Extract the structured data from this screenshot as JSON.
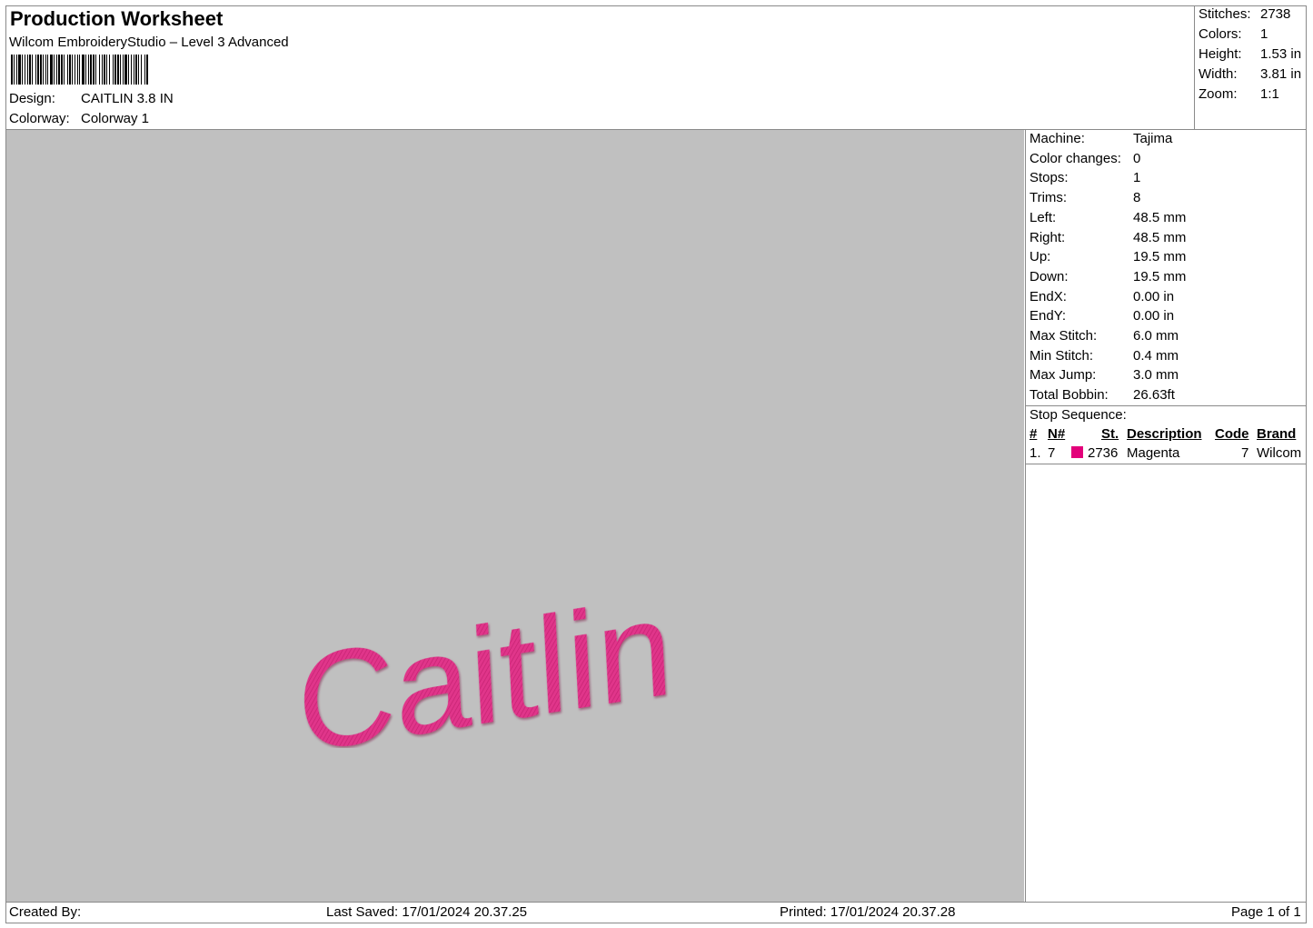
{
  "header": {
    "title": "Production Worksheet",
    "software": "Wilcom EmbroideryStudio – Level 3 Advanced",
    "design_label": "Design:",
    "design_value": "CAITLIN 3.8 IN",
    "colorway_label": "Colorway:",
    "colorway_value": "Colorway 1"
  },
  "summary": [
    {
      "label": "Stitches:",
      "value": "2738"
    },
    {
      "label": "Colors:",
      "value": "1"
    },
    {
      "label": "Height:",
      "value": "1.53 in"
    },
    {
      "label": "Width:",
      "value": "3.81 in"
    },
    {
      "label": "Zoom:",
      "value": "1:1"
    }
  ],
  "machine_info": [
    {
      "label": "Machine:",
      "value": "Tajima"
    },
    {
      "label": "Color changes:",
      "value": "0"
    },
    {
      "label": "Stops:",
      "value": "1"
    },
    {
      "label": "Trims:",
      "value": "8"
    },
    {
      "label": "Left:",
      "value": "48.5 mm"
    },
    {
      "label": "Right:",
      "value": "48.5 mm"
    },
    {
      "label": "Up:",
      "value": "19.5 mm"
    },
    {
      "label": "Down:",
      "value": "19.5 mm"
    },
    {
      "label": "EndX:",
      "value": "0.00 in"
    },
    {
      "label": "EndY:",
      "value": "0.00 in"
    },
    {
      "label": "Max Stitch:",
      "value": "6.0 mm"
    },
    {
      "label": "Min Stitch:",
      "value": "0.4 mm"
    },
    {
      "label": "Max Jump:",
      "value": "3.0 mm"
    },
    {
      "label": "Total Bobbin:",
      "value": "26.63ft"
    }
  ],
  "stop_sequence": {
    "title": "Stop Sequence:",
    "headers": {
      "num": "#",
      "n": "N#",
      "st": "St.",
      "description": "Description",
      "code": "Code",
      "brand": "Brand"
    },
    "rows": [
      {
        "num": "1.",
        "n": "7",
        "color": "#e3007a",
        "st": "2736",
        "description": "Magenta",
        "code": "7",
        "brand": "Wilcom"
      }
    ]
  },
  "design_preview": {
    "text": "Caitlin",
    "thread_color": "#e0348a",
    "background": "#c0c0c0"
  },
  "footer": {
    "created_by": "Created By:",
    "last_saved": "Last Saved: 17/01/2024 20.37.25",
    "printed": "Printed: 17/01/2024 20.37.28",
    "page": "Page 1 of 1"
  }
}
